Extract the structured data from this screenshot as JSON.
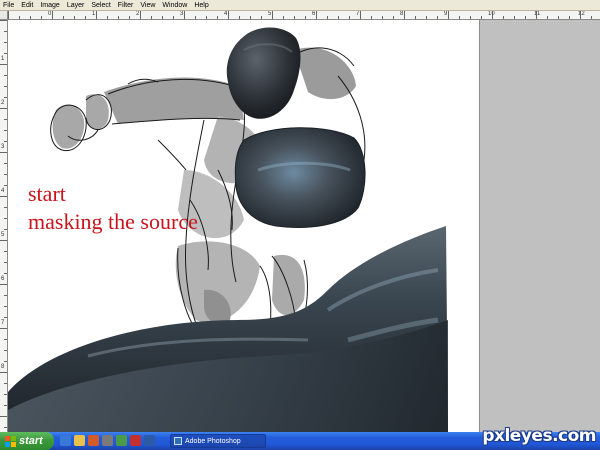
{
  "menu": {
    "items": [
      "File",
      "Edit",
      "Image",
      "Layer",
      "Select",
      "Filter",
      "View",
      "Window",
      "Help"
    ]
  },
  "rulers": {
    "top_labels": [
      "0",
      "1",
      "2",
      "3",
      "4",
      "5",
      "6",
      "7",
      "8",
      "9",
      "10",
      "11",
      "12"
    ],
    "left_labels": [
      "1",
      "2",
      "3",
      "4",
      "5",
      "6",
      "7",
      "8"
    ]
  },
  "canvas": {
    "caption_line1": "start",
    "caption_line2": "masking the source",
    "caption_color": "#c8141c"
  },
  "taskbar": {
    "start_label": "start",
    "task_label": "Adobe Photoshop"
  },
  "watermark": "pxleyes.com"
}
